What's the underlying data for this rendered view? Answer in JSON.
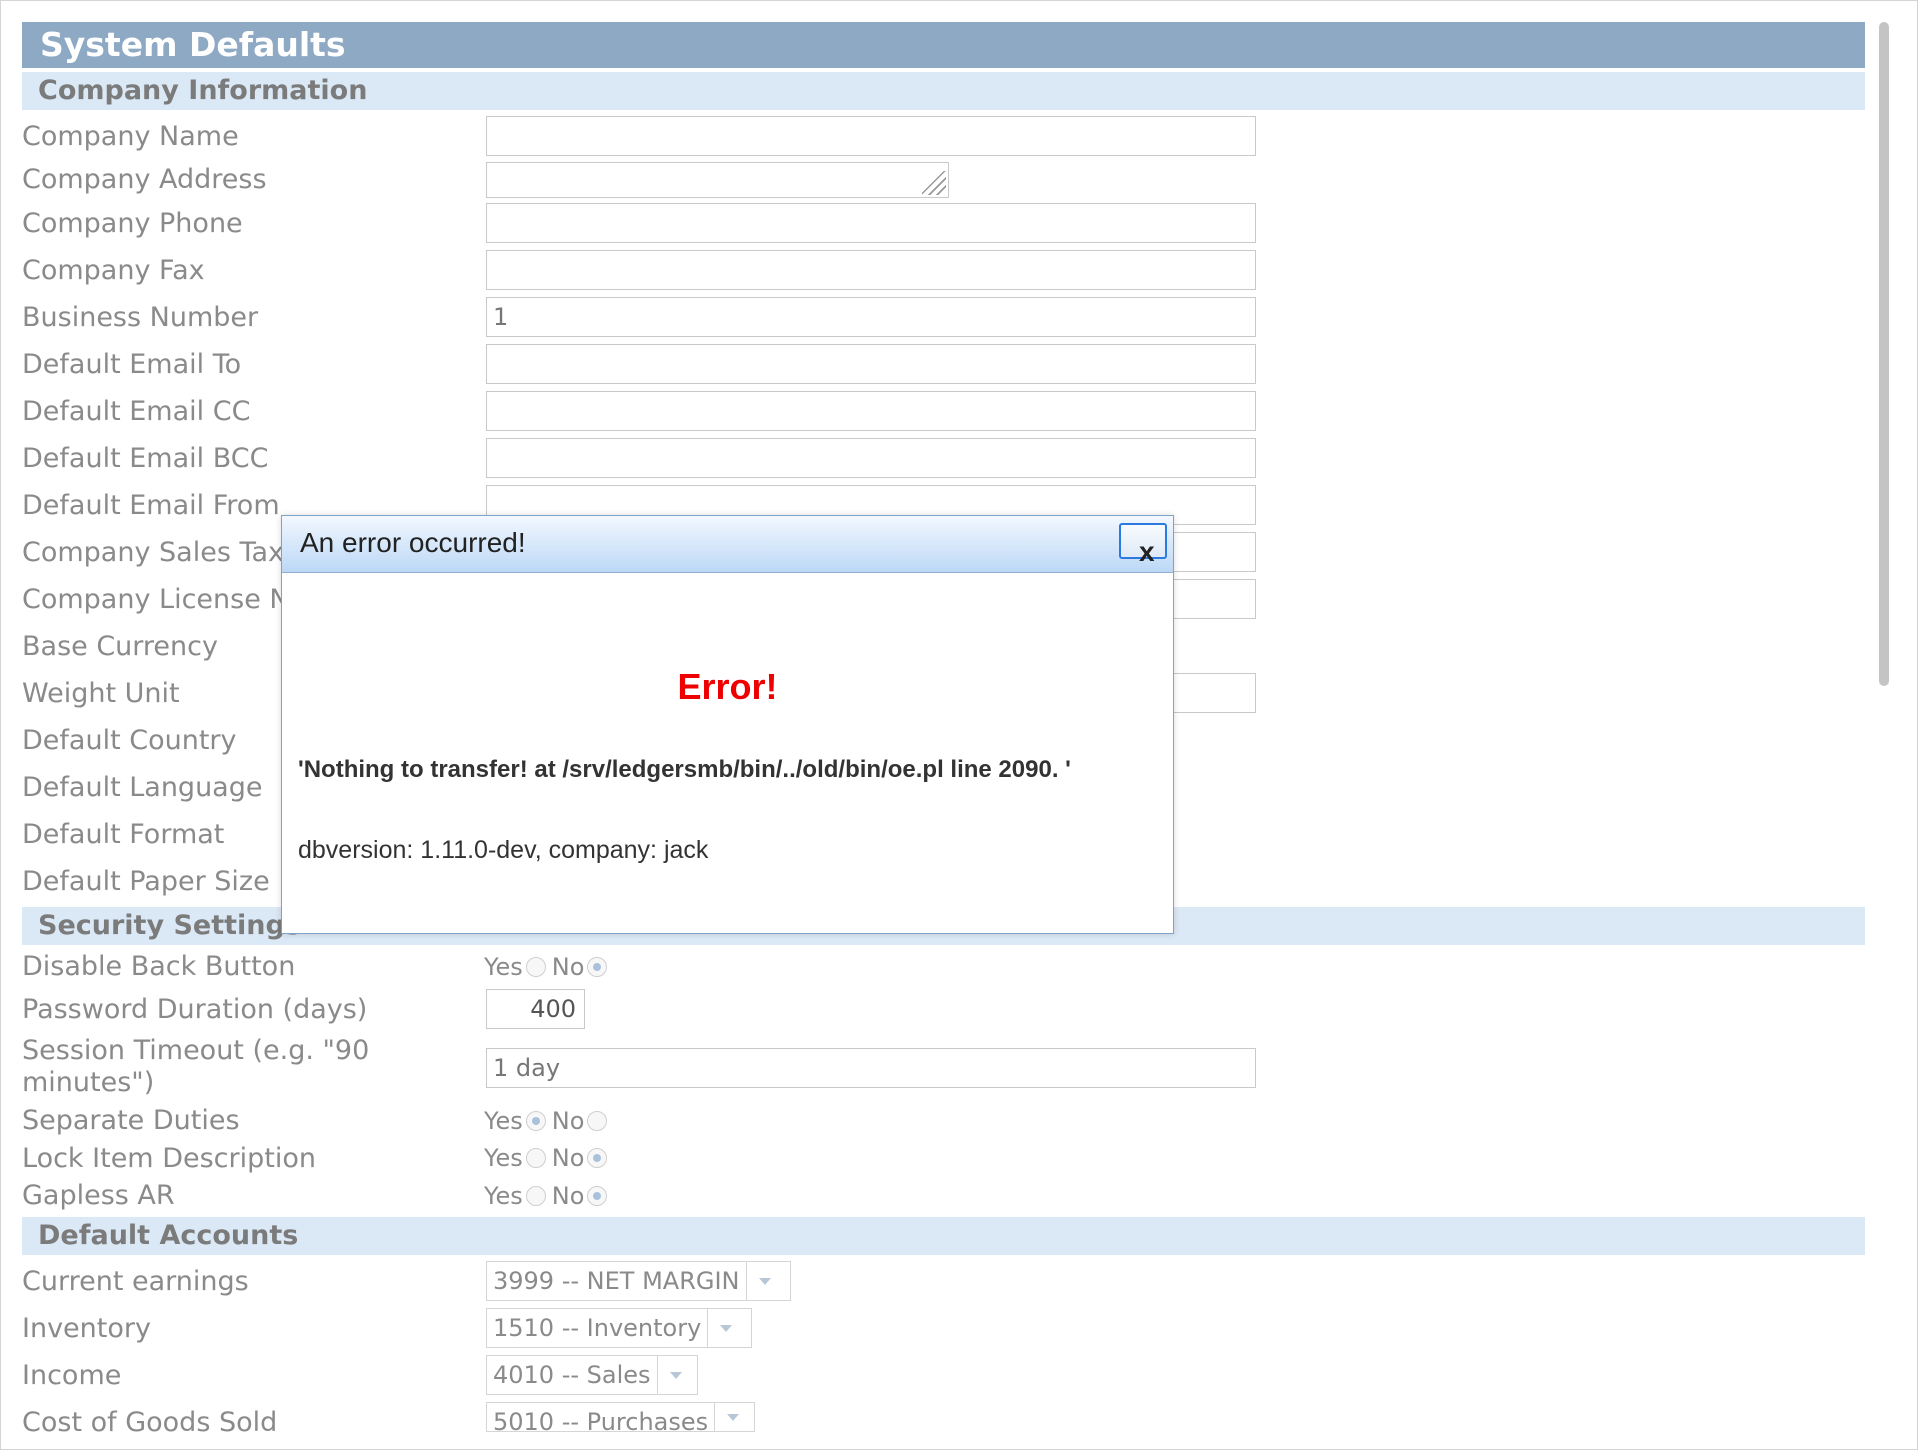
{
  "page_title": "System Defaults",
  "sections": {
    "company": "Company Information",
    "security": "Security Settings",
    "accounts": "Default Accounts"
  },
  "company_fields": {
    "company_name": {
      "label": "Company Name",
      "value": ""
    },
    "company_address": {
      "label": "Company Address",
      "value": ""
    },
    "company_phone": {
      "label": "Company Phone",
      "value": ""
    },
    "company_fax": {
      "label": "Company Fax",
      "value": ""
    },
    "business_number": {
      "label": "Business Number",
      "value": "1"
    },
    "default_email_to": {
      "label": "Default Email To",
      "value": ""
    },
    "default_email_cc": {
      "label": "Default Email CC",
      "value": ""
    },
    "default_email_bcc": {
      "label": "Default Email BCC",
      "value": ""
    },
    "default_email_from": {
      "label": "Default Email From",
      "value": ""
    },
    "company_sales_tax": {
      "label": "Company Sales Tax",
      "value": ""
    },
    "company_license": {
      "label": "Company License N",
      "value": ""
    },
    "base_currency": {
      "label": "Base Currency"
    },
    "weight_unit": {
      "label": "Weight Unit",
      "value": ""
    },
    "default_country": {
      "label": "Default Country"
    },
    "default_language": {
      "label": "Default Language"
    },
    "default_format": {
      "label": "Default Format"
    },
    "default_paper_size": {
      "label": "Default Paper Size"
    }
  },
  "security": {
    "disable_back_button": {
      "label": "Disable Back Button",
      "selected": "No"
    },
    "password_duration": {
      "label": "Password Duration (days)",
      "value": "400"
    },
    "session_timeout": {
      "label": "Session Timeout (e.g. \"90 minutes\")",
      "value": "1 day"
    },
    "separate_duties": {
      "label": "Separate Duties",
      "selected": "Yes"
    },
    "lock_item_description": {
      "label": "Lock Item Description",
      "selected": "No"
    },
    "gapless_ar": {
      "label": "Gapless AR",
      "selected": "No"
    },
    "yes_label": "Yes",
    "no_label": "No"
  },
  "accounts": {
    "current_earnings": {
      "label": "Current earnings",
      "value": "3999 -- NET MARGIN"
    },
    "inventory": {
      "label": "Inventory",
      "value": "1510 -- Inventory"
    },
    "income": {
      "label": "Income",
      "value": "4010 -- Sales"
    },
    "cogs": {
      "label": "Cost of Goods Sold",
      "value": "5010 -- Purchases"
    }
  },
  "dialog": {
    "title": "An error occurred!",
    "close_label": "x",
    "heading": "Error!",
    "message": "'Nothing to transfer! at /srv/ledgersmb/bin/../old/bin/oe.pl line 2090. '",
    "meta": "dbversion: 1.11.0-dev, company: jack"
  }
}
